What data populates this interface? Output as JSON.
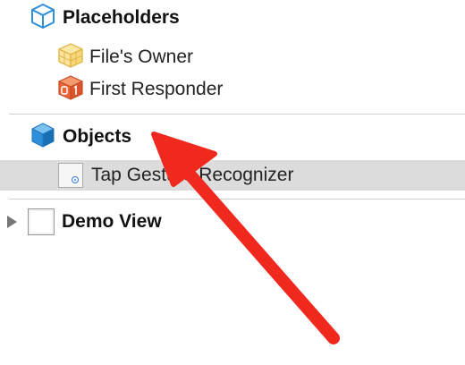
{
  "outline": {
    "placeholders": {
      "header_label": "Placeholders",
      "icon": "cube-icon",
      "items": [
        {
          "label": "File's Owner",
          "icon": "files-owner-cube-icon"
        },
        {
          "label": "First Responder",
          "icon": "first-responder-cube-icon"
        }
      ]
    },
    "objects": {
      "header_label": "Objects",
      "icon": "cube-icon",
      "items": [
        {
          "label": "Tap Gesture Recognizer",
          "icon": "gesture-recognizer-icon",
          "selected": true
        }
      ]
    },
    "views": [
      {
        "label": "Demo View",
        "icon": "view-icon",
        "expanded": false
      }
    ]
  },
  "colors": {
    "cube_blue": "#2f8fd8",
    "files_owner_yellow": "#f7d77a",
    "first_responder_orange": "#e8663a",
    "selection_gray": "#dcdcdc",
    "arrow_red": "#f0291e"
  },
  "annotation": {
    "icon": "red-arrow-annotation"
  }
}
